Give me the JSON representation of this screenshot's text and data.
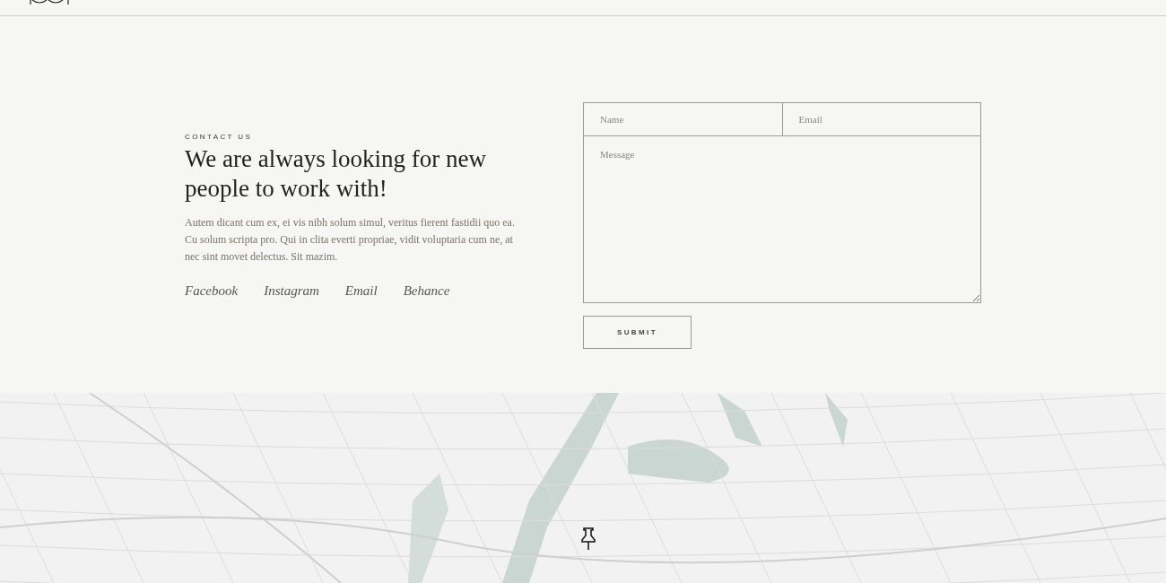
{
  "contact": {
    "eyebrow": "CONTACT US",
    "heading": "We are always looking for new people to work with!",
    "body": "Autem dicant cum ex, ei vis nibh solum simul, veritus fierent fastidii quo ea. Cu solum scripta pro. Qui in clita everti propriae, vidit voluptaria cum ne, at nec sint movet delectus. Sit mazim.",
    "links": [
      "Facebook",
      "Instagram",
      "Email",
      "Behance"
    ]
  },
  "form": {
    "fields": [
      {
        "kind": "input",
        "placeholder": "Name"
      },
      {
        "kind": "input",
        "placeholder": "Email"
      },
      {
        "kind": "textarea",
        "placeholder": "Message"
      }
    ],
    "submit": "SUBMIT"
  }
}
